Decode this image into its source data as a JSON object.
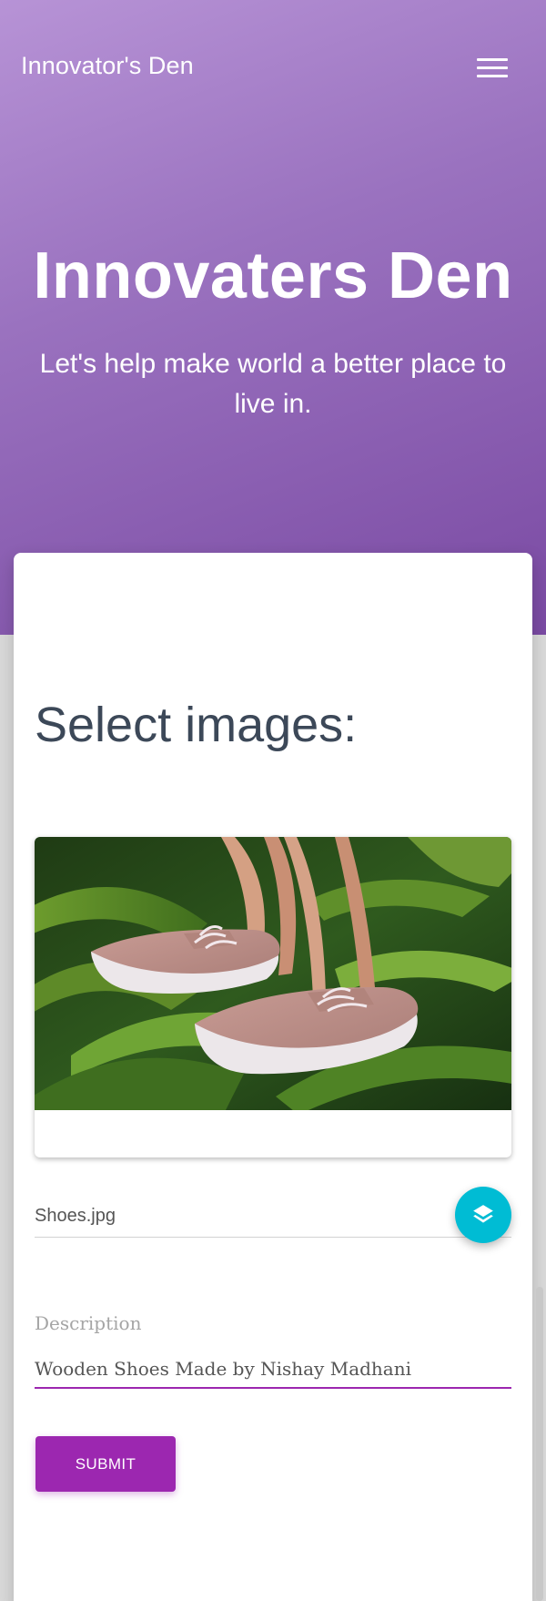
{
  "header": {
    "brand": "Innovator's Den",
    "menu_icon": "hamburger-menu-icon"
  },
  "hero": {
    "title": "Innovaters Den",
    "subtitle": "Let's help make world a better place to live in."
  },
  "upload": {
    "section_title": "Select images:",
    "image_alt": "Pink knit shoes among green leaves",
    "file_name": "Shoes.jpg",
    "file_button_icon": "layers-icon"
  },
  "description": {
    "label": "Description",
    "value": "Wooden Shoes Made by Nishay Madhani"
  },
  "actions": {
    "submit_label": "SUBMIT"
  },
  "colors": {
    "primary": "#9c27b0",
    "info": "#00bcd4",
    "heading": "#3c4858",
    "header_gradient_start": "#b793d6",
    "header_gradient_end": "#7a4aa3"
  }
}
